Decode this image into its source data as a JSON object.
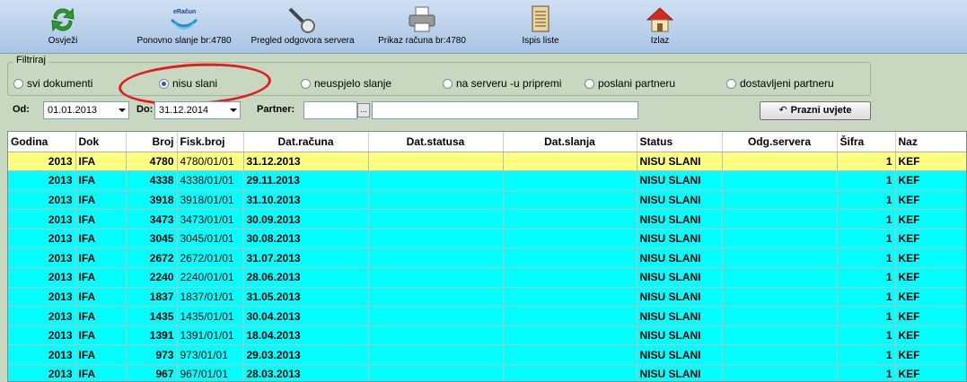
{
  "toolbar": {
    "buttons": [
      {
        "label": "Osvježi",
        "icon": "refresh-icon"
      },
      {
        "label": "Ponovno slanje br:4780",
        "icon": "eracun-logo-icon"
      },
      {
        "label": "Pregled odgovora servera",
        "icon": "magnifier-icon"
      },
      {
        "label": "Prikaz računa br:4780",
        "icon": "printer-icon"
      },
      {
        "label": "Ispis liste",
        "icon": "document-list-icon"
      },
      {
        "label": "Izlaz",
        "icon": "home-icon"
      }
    ],
    "logo_text": "eRačun"
  },
  "filter": {
    "legend": "Filtriraj",
    "options": [
      {
        "label": "svi dokumenti",
        "selected": false
      },
      {
        "label": "nisu slani",
        "selected": true
      },
      {
        "label": "neuspjelo slanje",
        "selected": false
      },
      {
        "label": "na serveru -u pripremi",
        "selected": false
      },
      {
        "label": "poslani partneru",
        "selected": false
      },
      {
        "label": "dostavljeni partneru",
        "selected": false
      }
    ]
  },
  "criteria": {
    "from_label": "Od:",
    "from_value": "01.01.2013",
    "to_label": "Do:",
    "to_value": "31.12.2014",
    "partner_label": "Partner:",
    "partner_code": "",
    "partner_name": "",
    "browse_label": "...",
    "clear_label": "Prazni uvjete"
  },
  "grid": {
    "columns": [
      "Godina",
      "Dok",
      "Broj",
      "Fisk.broj",
      "Dat.računa",
      "Dat.statusa",
      "Dat.slanja",
      "Status",
      "Odg.servera",
      "Šifra",
      "Naz"
    ],
    "rows": [
      [
        "2013",
        "IFA",
        "4780",
        "4780/01/01",
        "31.12.2013",
        "",
        "",
        "NISU SLANI",
        "",
        "1",
        "KEF"
      ],
      [
        "2013",
        "IFA",
        "4338",
        "4338/01/01",
        "29.11.2013",
        "",
        "",
        "NISU SLANI",
        "",
        "1",
        "KEF"
      ],
      [
        "2013",
        "IFA",
        "3918",
        "3918/01/01",
        "31.10.2013",
        "",
        "",
        "NISU SLANI",
        "",
        "1",
        "KEF"
      ],
      [
        "2013",
        "IFA",
        "3473",
        "3473/01/01",
        "30.09.2013",
        "",
        "",
        "NISU SLANI",
        "",
        "1",
        "KEF"
      ],
      [
        "2013",
        "IFA",
        "3045",
        "3045/01/01",
        "30.08.2013",
        "",
        "",
        "NISU SLANI",
        "",
        "1",
        "KEF"
      ],
      [
        "2013",
        "IFA",
        "2672",
        "2672/01/01",
        "31.07.2013",
        "",
        "",
        "NISU SLANI",
        "",
        "1",
        "KEF"
      ],
      [
        "2013",
        "IFA",
        "2240",
        "2240/01/01",
        "28.06.2013",
        "",
        "",
        "NISU SLANI",
        "",
        "1",
        "KEF"
      ],
      [
        "2013",
        "IFA",
        "1837",
        "1837/01/01",
        "31.05.2013",
        "",
        "",
        "NISU SLANI",
        "",
        "1",
        "KEF"
      ],
      [
        "2013",
        "IFA",
        "1435",
        "1435/01/01",
        "30.04.2013",
        "",
        "",
        "NISU SLANI",
        "",
        "1",
        "KEF"
      ],
      [
        "2013",
        "IFA",
        "1391",
        "1391/01/01",
        "18.04.2013",
        "",
        "",
        "NISU SLANI",
        "",
        "1",
        "KEF"
      ],
      [
        "2013",
        "IFA",
        "973",
        "973/01/01",
        "29.03.2013",
        "",
        "",
        "NISU SLANI",
        "",
        "1",
        "KEF"
      ],
      [
        "2013",
        "IFA",
        "967",
        "967/01/01",
        "28.03.2013",
        "",
        "",
        "NISU SLANI",
        "",
        "1",
        "KEF"
      ]
    ],
    "selected_row": 0
  },
  "colors": {
    "row_bg": "#00ffff",
    "selected_row_bg": "#ffff80",
    "highlight_ring": "#e01e1e"
  }
}
